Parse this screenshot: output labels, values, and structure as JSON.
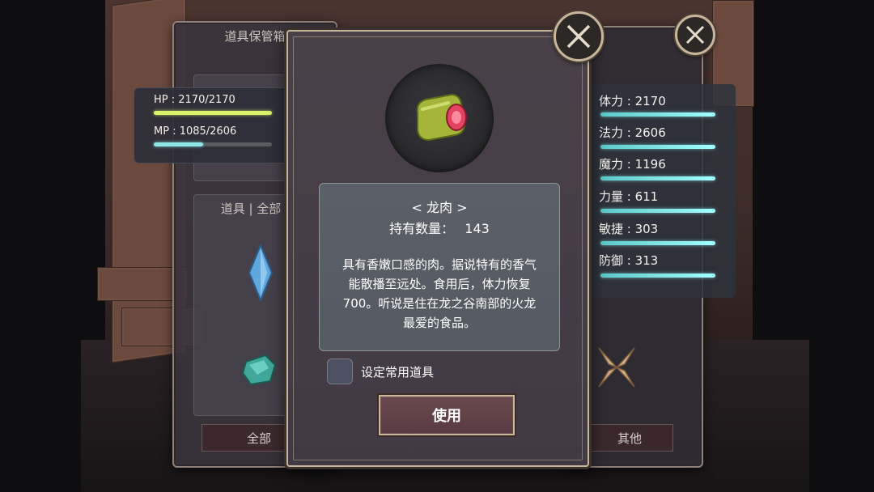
{
  "inventory_panel": {
    "title": "道具保管箱",
    "hp_label": "HP : 2170/2170",
    "hp_fraction": 1.0,
    "mp_label": "MP : 1085/2606",
    "mp_fraction": 0.416,
    "items_header": "道具 | 全部",
    "tab_all": "全部"
  },
  "stats_panel": {
    "stats": [
      {
        "label": "体力 : 2170"
      },
      {
        "label": "法力 : 2606"
      },
      {
        "label": "魔力 : 1196"
      },
      {
        "label": "力量 : 611"
      },
      {
        "label": "敏捷 : 303"
      },
      {
        "label": "防御 : 313"
      }
    ],
    "tab_other": "其他"
  },
  "item_dialog": {
    "item_name": "< 龙肉 >",
    "quantity_label": "持有数量：",
    "quantity_value": "143",
    "description": "具有香嫩口感的肉。据说特有的香气能散播至远处。食用后，体力恢复700。听说是住在龙之谷南部的火龙最爱的食品。",
    "favorite_checkbox_label": "设定常用道具",
    "favorite_checked": false,
    "use_button": "使用"
  },
  "colors": {
    "hp_bar": "#d8f26a",
    "mp_bar": "#8ee6e6",
    "stat_bar": "#9ef7f7",
    "dialog_border": "#c6b597"
  },
  "icons": {
    "item_icon": "dragon-meat-icon",
    "close_icon": "close-icon"
  }
}
